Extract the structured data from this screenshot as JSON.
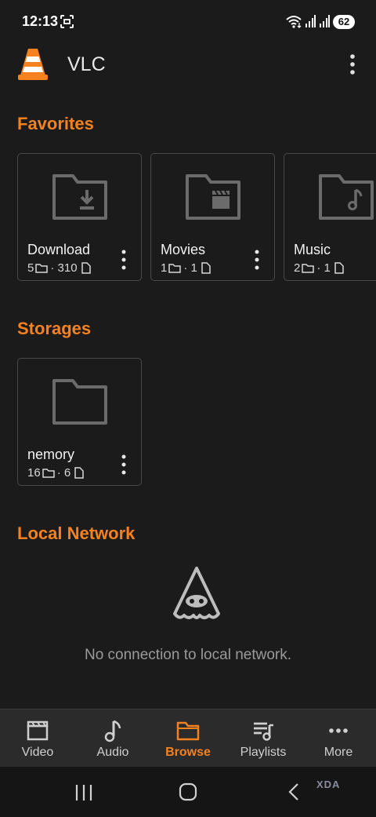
{
  "status_bar": {
    "time": "12:13",
    "battery": "62",
    "icons": [
      "screenshot-icon",
      "wifi-icon",
      "signal-icon",
      "signal-icon",
      "battery-icon"
    ]
  },
  "app_bar": {
    "title": "VLC",
    "logo": "vlc-cone-icon",
    "menu_icon": "more-vert-icon"
  },
  "sections": {
    "favorites": "Favorites",
    "storages": "Storages",
    "local_network": "Local Network"
  },
  "favorites": [
    {
      "name": "Download",
      "folders": "5",
      "files": "310",
      "icon": "download-folder-icon"
    },
    {
      "name": "Movies",
      "folders": "1",
      "files": "1",
      "icon": "movie-folder-icon"
    },
    {
      "name": "Music",
      "folders": "2",
      "files": "1",
      "icon": "music-folder-icon"
    }
  ],
  "storages": [
    {
      "name": "nemory",
      "folders": "16",
      "files": "6",
      "icon": "folder-icon"
    }
  ],
  "local_network": {
    "empty_message": "No connection to local network."
  },
  "bottom_nav": {
    "items": [
      {
        "label": "Video",
        "icon": "video-icon"
      },
      {
        "label": "Audio",
        "icon": "music-note-icon"
      },
      {
        "label": "Browse",
        "icon": "folder-icon"
      },
      {
        "label": "Playlists",
        "icon": "playlist-icon"
      },
      {
        "label": "More",
        "icon": "more-horiz-icon"
      }
    ],
    "active": "Browse"
  },
  "watermark": "XDA",
  "colors": {
    "accent": "#f5821f",
    "background": "#1b1b1b",
    "nav_background": "#2b2b2b"
  }
}
